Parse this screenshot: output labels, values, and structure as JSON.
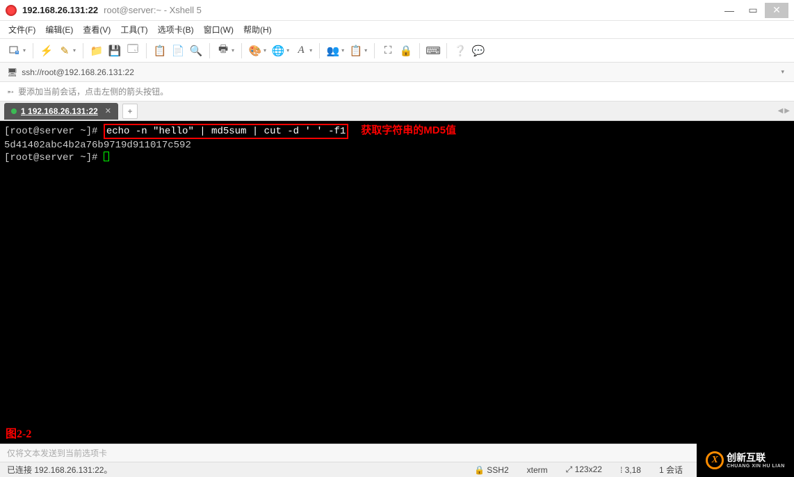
{
  "title": {
    "host": "192.168.26.131:22",
    "suffix": "root@server:~ - Xshell 5"
  },
  "menu": {
    "file": "文件(F)",
    "edit": "编辑(E)",
    "view": "查看(V)",
    "tools": "工具(T)",
    "tabs": "选项卡(B)",
    "window": "窗口(W)",
    "help": "帮助(H)"
  },
  "address": {
    "url": "ssh://root@192.168.26.131:22"
  },
  "hint": {
    "text": "要添加当前会话，点击左侧的箭头按钮。"
  },
  "tab": {
    "index": "1",
    "label": "192.168.26.131:22"
  },
  "terminal": {
    "prompt1_prefix": "[root@server ~]# ",
    "command": "echo -n \"hello\" | md5sum | cut -d ' ' -f1",
    "annotation": "获取字符串的MD5值",
    "output": "5d41402abc4b2a76b9719d911017c592",
    "prompt2": "[root@server ~]# ",
    "figure_label": "图2-2"
  },
  "sendbar": {
    "placeholder": "仅将文本发送到当前选项卡"
  },
  "status": {
    "conn": "已连接  192.168.26.131:22。",
    "proto": "SSH2",
    "term": "xterm",
    "size": "123x22",
    "pos": "3,18",
    "sess": "1 会话"
  },
  "watermark": {
    "brand": "创新互联",
    "sub": "CHUANG  XIN  HU  LIAN"
  }
}
